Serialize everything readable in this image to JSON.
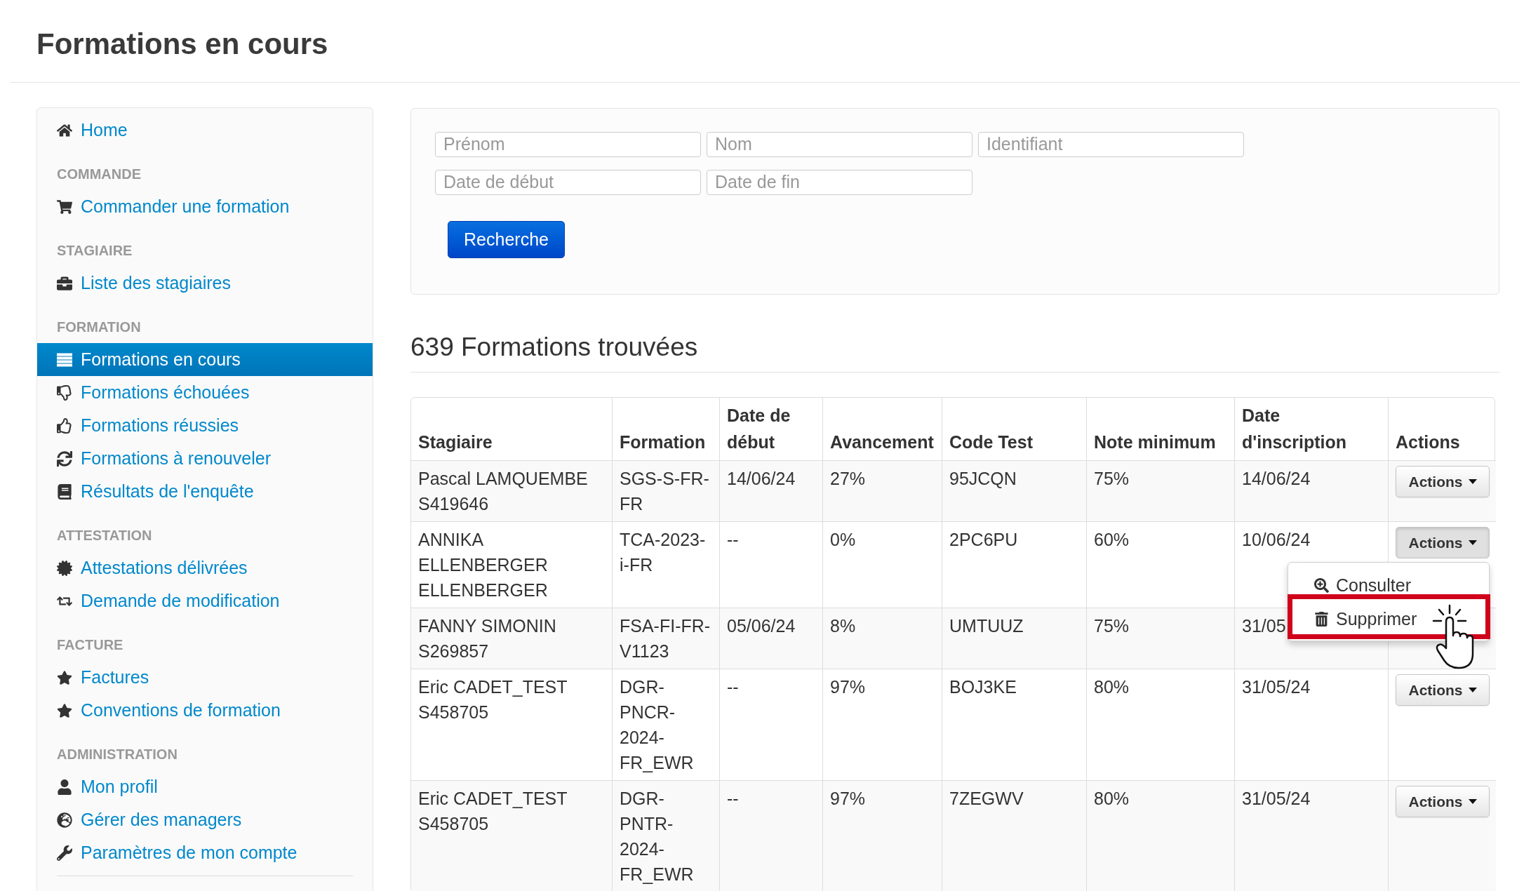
{
  "page": {
    "title": "Formations en cours"
  },
  "sidebar": {
    "entries": [
      {
        "kind": "link",
        "label": "Home",
        "selected": false
      },
      {
        "kind": "heading",
        "label": "COMMANDE"
      },
      {
        "kind": "link",
        "label": "Commander une formation",
        "selected": false
      },
      {
        "kind": "heading",
        "label": "STAGIAIRE"
      },
      {
        "kind": "link",
        "label": "Liste des stagiaires",
        "selected": false
      },
      {
        "kind": "heading",
        "label": "FORMATION"
      },
      {
        "kind": "link",
        "label": "Formations en cours",
        "selected": true
      },
      {
        "kind": "link",
        "label": "Formations échouées",
        "selected": false
      },
      {
        "kind": "link",
        "label": "Formations réussies",
        "selected": false
      },
      {
        "kind": "link",
        "label": "Formations à renouveler",
        "selected": false
      },
      {
        "kind": "link",
        "label": "Résultats de l'enquête",
        "selected": false
      },
      {
        "kind": "heading",
        "label": "ATTESTATION"
      },
      {
        "kind": "link",
        "label": "Attestations délivrées",
        "selected": false
      },
      {
        "kind": "link",
        "label": "Demande de modification",
        "selected": false
      },
      {
        "kind": "heading",
        "label": "FACTURE"
      },
      {
        "kind": "link",
        "label": "Factures",
        "selected": false
      },
      {
        "kind": "link",
        "label": "Conventions de formation",
        "selected": false
      },
      {
        "kind": "heading",
        "label": "ADMINISTRATION"
      },
      {
        "kind": "link",
        "label": "Mon profil",
        "selected": false
      },
      {
        "kind": "link",
        "label": "Gérer des managers",
        "selected": false
      },
      {
        "kind": "link",
        "label": "Paramètres de mon compte",
        "selected": false
      }
    ]
  },
  "search": {
    "rows": [
      [
        {
          "placeholder": "Prénom"
        },
        {
          "placeholder": "Nom"
        },
        {
          "placeholder": "Identifiant"
        }
      ],
      [
        {
          "placeholder": "Date de début"
        },
        {
          "placeholder": "Date de fin"
        }
      ]
    ],
    "button": "Recherche"
  },
  "results": {
    "heading": "639 Formations trouvées",
    "table": {
      "columns": [
        "Stagiaire",
        "Formation",
        "Date de début",
        "Avancement",
        "Code Test",
        "Note minimum",
        "Date d'inscription",
        "Actions"
      ],
      "rows": [
        {
          "cells": [
            "Pascal LAMQUEMBE\nS419646",
            "SGS-S-FR-FR",
            "14/06/24",
            "27%",
            "95JCQN",
            "75%",
            "14/06/24"
          ],
          "actions": {
            "label": "Actions",
            "pressed": false
          }
        },
        {
          "cells": [
            "ANNIKA ELLENBERGER ELLENBERGER",
            "TCA-2023-i-FR",
            "--",
            "0%",
            "2PC6PU",
            "60%",
            "10/06/24"
          ],
          "actions": {
            "label": "Actions",
            "pressed": true,
            "menu": [
              {
                "label": "Consulter",
                "highlighted": false
              },
              {
                "label": "Supprimer",
                "highlighted": true
              }
            ]
          }
        },
        {
          "cells": [
            "FANNY SIMONIN\nS269857",
            "FSA-FI-FR-V1123",
            "05/06/24",
            "8%",
            "UMTUUZ",
            "75%",
            "31/05"
          ]
        },
        {
          "cells": [
            "Eric CADET_TEST\nS458705",
            "DGR-PNCR-2024-FR_EWR",
            "--",
            "97%",
            "BOJ3KE",
            "80%",
            "31/05/24"
          ],
          "actions": {
            "label": "Actions",
            "pressed": false
          }
        },
        {
          "cells": [
            "Eric CADET_TEST\nS458705",
            "DGR-PNTR-2024-FR_EWR",
            "--",
            "97%",
            "7ZEGWV",
            "80%",
            "31/05/24"
          ],
          "actions": {
            "label": "Actions",
            "pressed": false
          }
        }
      ]
    }
  }
}
